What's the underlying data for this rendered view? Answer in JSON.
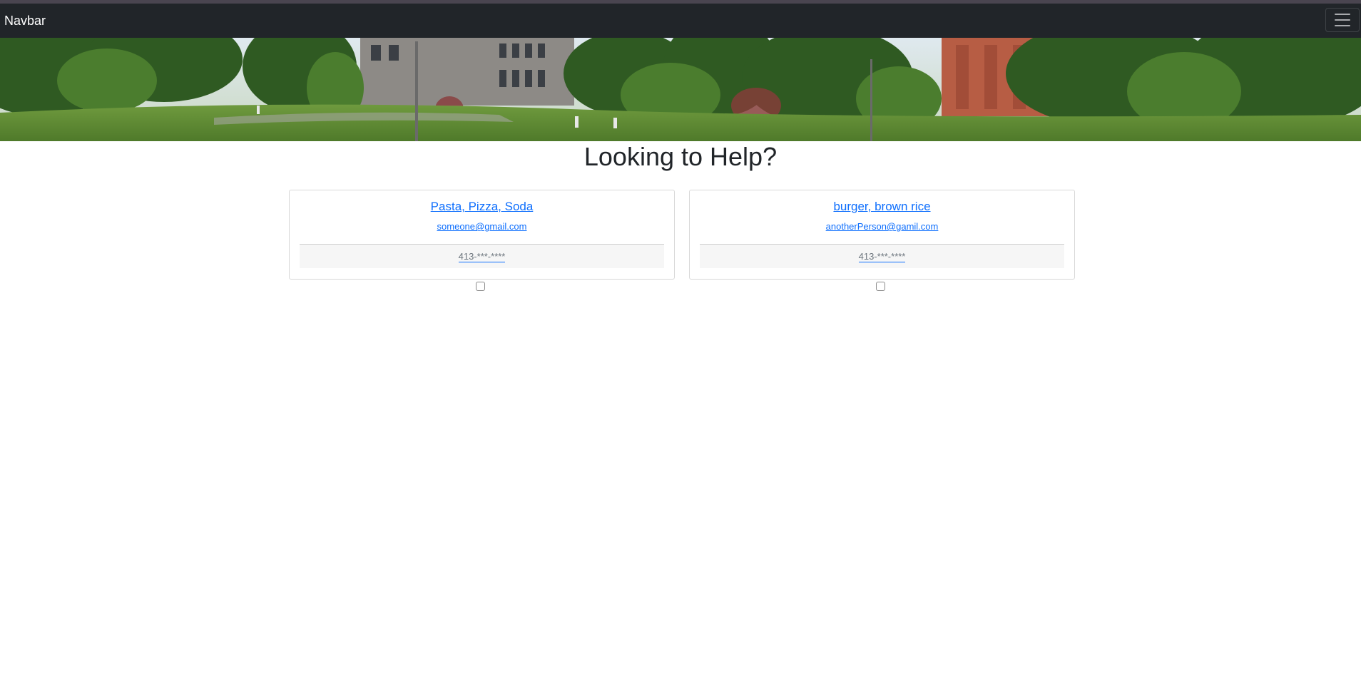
{
  "navbar": {
    "brand": "Navbar",
    "toggler_icon": "hamburger-menu-icon",
    "background": "#212529"
  },
  "hero": {
    "description_icon": "campus-banner-image"
  },
  "main": {
    "heading": "Looking to Help?",
    "cards": [
      {
        "title": "Pasta, Pizza, Soda",
        "email": "someone@gmail.com",
        "phone": "413-***-****"
      },
      {
        "title": "burger, brown rice",
        "email": "anotherPerson@gamil.com",
        "phone": "413-***-****"
      }
    ]
  },
  "colors": {
    "link": "#0d6efd",
    "muted": "#6c757d",
    "footer_bg": "#f6f6f6"
  }
}
